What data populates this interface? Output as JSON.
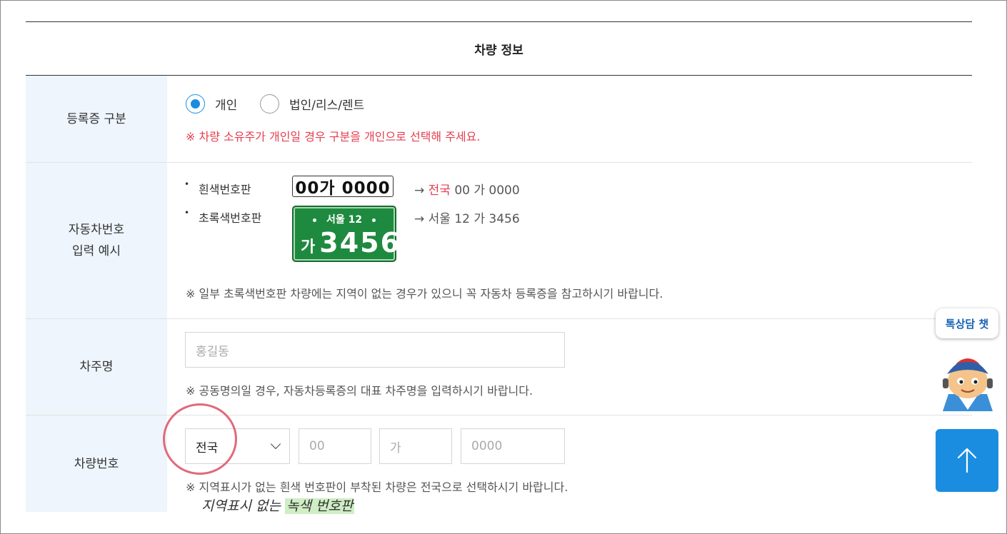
{
  "section": {
    "title": "차량 정보"
  },
  "registration": {
    "label": "등록증 구분",
    "options": [
      {
        "label": "개인",
        "checked": true
      },
      {
        "label": "법인/리스/렌트",
        "checked": false
      }
    ],
    "note": "※ 차량 소유주가 개인일 경우 구분을 개인으로 선택해 주세요."
  },
  "example": {
    "label_line1": "자동차번호",
    "label_line2": "입력 예시",
    "white": {
      "name": "흰색번호판",
      "plate_text": "00가 0000",
      "arrow": "→ ",
      "region": "전국",
      "result": " 00 가 0000"
    },
    "green": {
      "name": "초록색번호판",
      "plate_top": "서울 12",
      "plate_kor": "가",
      "plate_num": "3456",
      "result": "→ 서울 12 가 3456"
    },
    "note": "※ 일부 초록색번호판 차량에는 지역이 없는 경우가 있으니 꼭 자동차 등록증을 참고하시기 바랍니다."
  },
  "owner": {
    "label": "차주명",
    "placeholder": "홍길동",
    "note": "※ 공동명의일 경우, 자동차등록증의 대표 차주명을 입력하시기 바랍니다."
  },
  "vehicle_number": {
    "label": "차량번호",
    "region_selected": "전국",
    "ph_number": "00",
    "ph_kor": "가",
    "ph_serial": "0000",
    "note": "※ 지역표시가 없는 흰색 번호판이 부착된 차량은 전국으로 선택하시기 바랍니다."
  },
  "annotation": {
    "text_before": "지역표시 없는 ",
    "highlight": "녹색 번호판"
  },
  "chat": {
    "label": "톡상담 챗"
  },
  "colors": {
    "accent": "#1a8de0",
    "red": "#e53e4e",
    "th_bg": "#eef5fc",
    "mark": "#e06a7a"
  }
}
